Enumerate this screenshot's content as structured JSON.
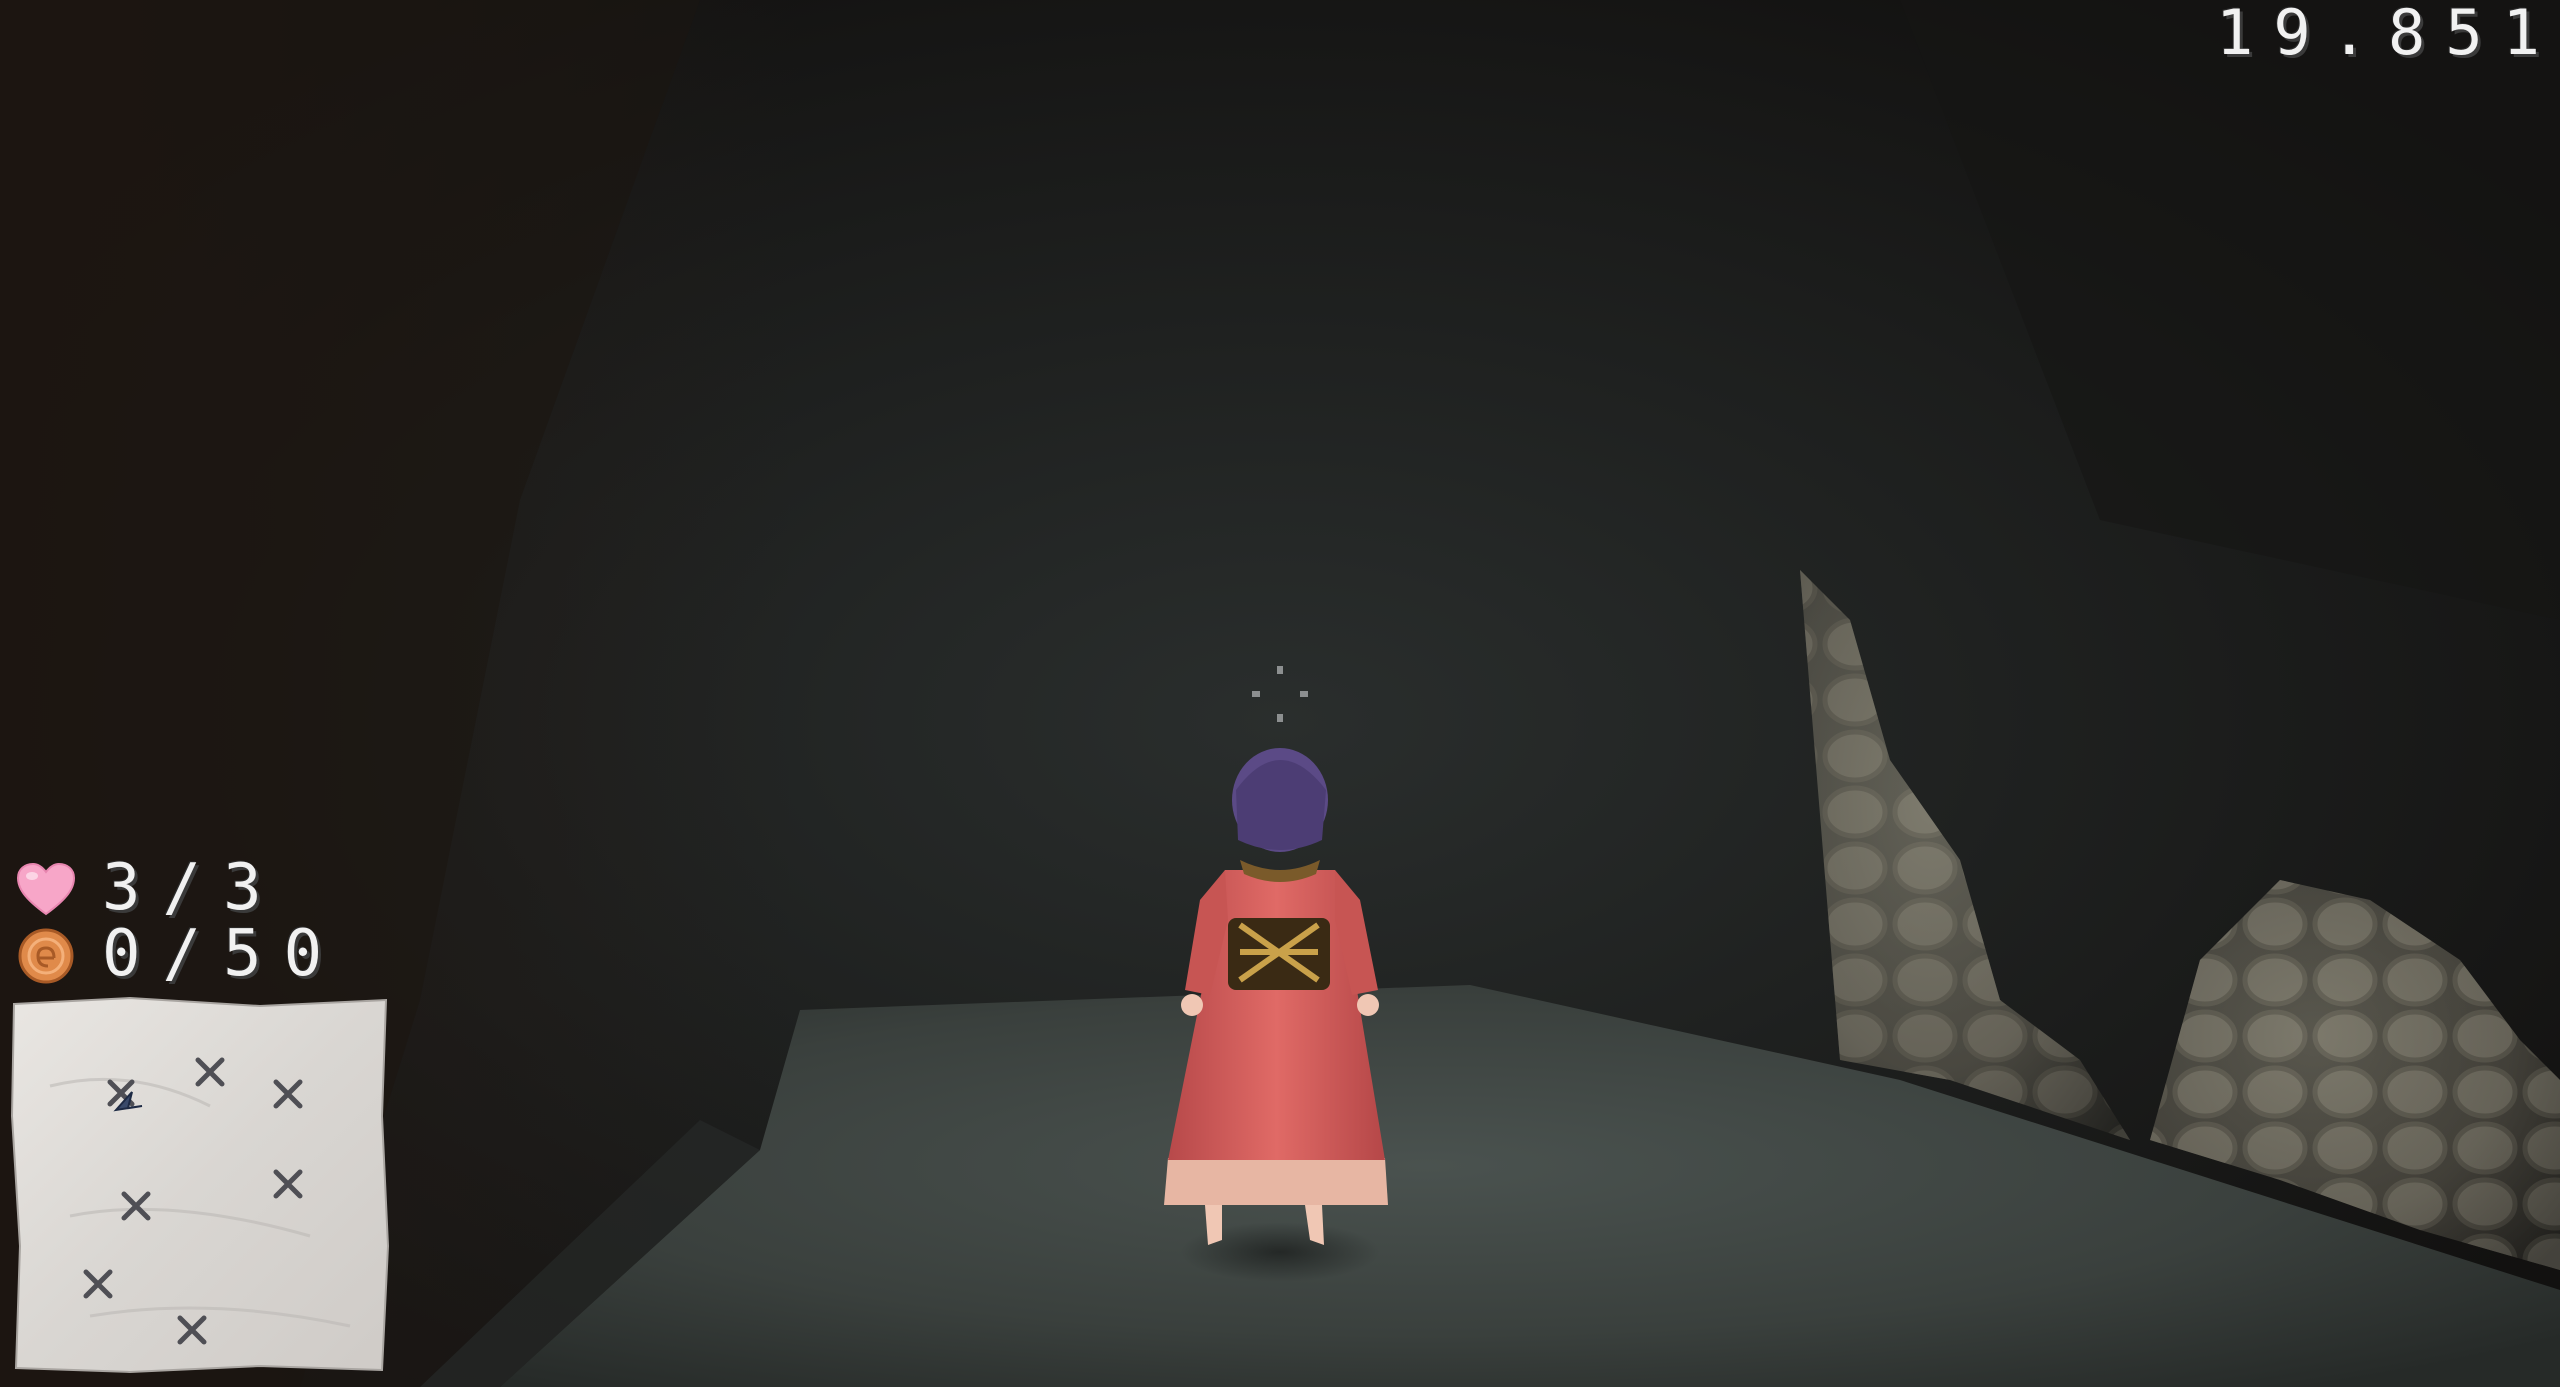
{
  "hud": {
    "timer": "19.851",
    "health": {
      "icon": "heart-icon",
      "value": "3/3",
      "color": "#f7a6c8"
    },
    "coins": {
      "icon": "coin-icon",
      "value": "0/50",
      "color": "#e08a4a"
    }
  },
  "minimap": {
    "icon": "map-scroll",
    "marker_icon": "x-mark-icon",
    "marker_count": 7,
    "player_marker": "arrow-icon"
  },
  "scene": {
    "setting": "dark-cave",
    "character": "player-in-red-kimono",
    "reticle": "crosshair-icon"
  },
  "colors": {
    "cave_dark": "#1a1918",
    "floor": "#3f4542",
    "kimono": "#d8605e",
    "hair": "#5a4a86",
    "hud_text": "#f1f1f1"
  }
}
